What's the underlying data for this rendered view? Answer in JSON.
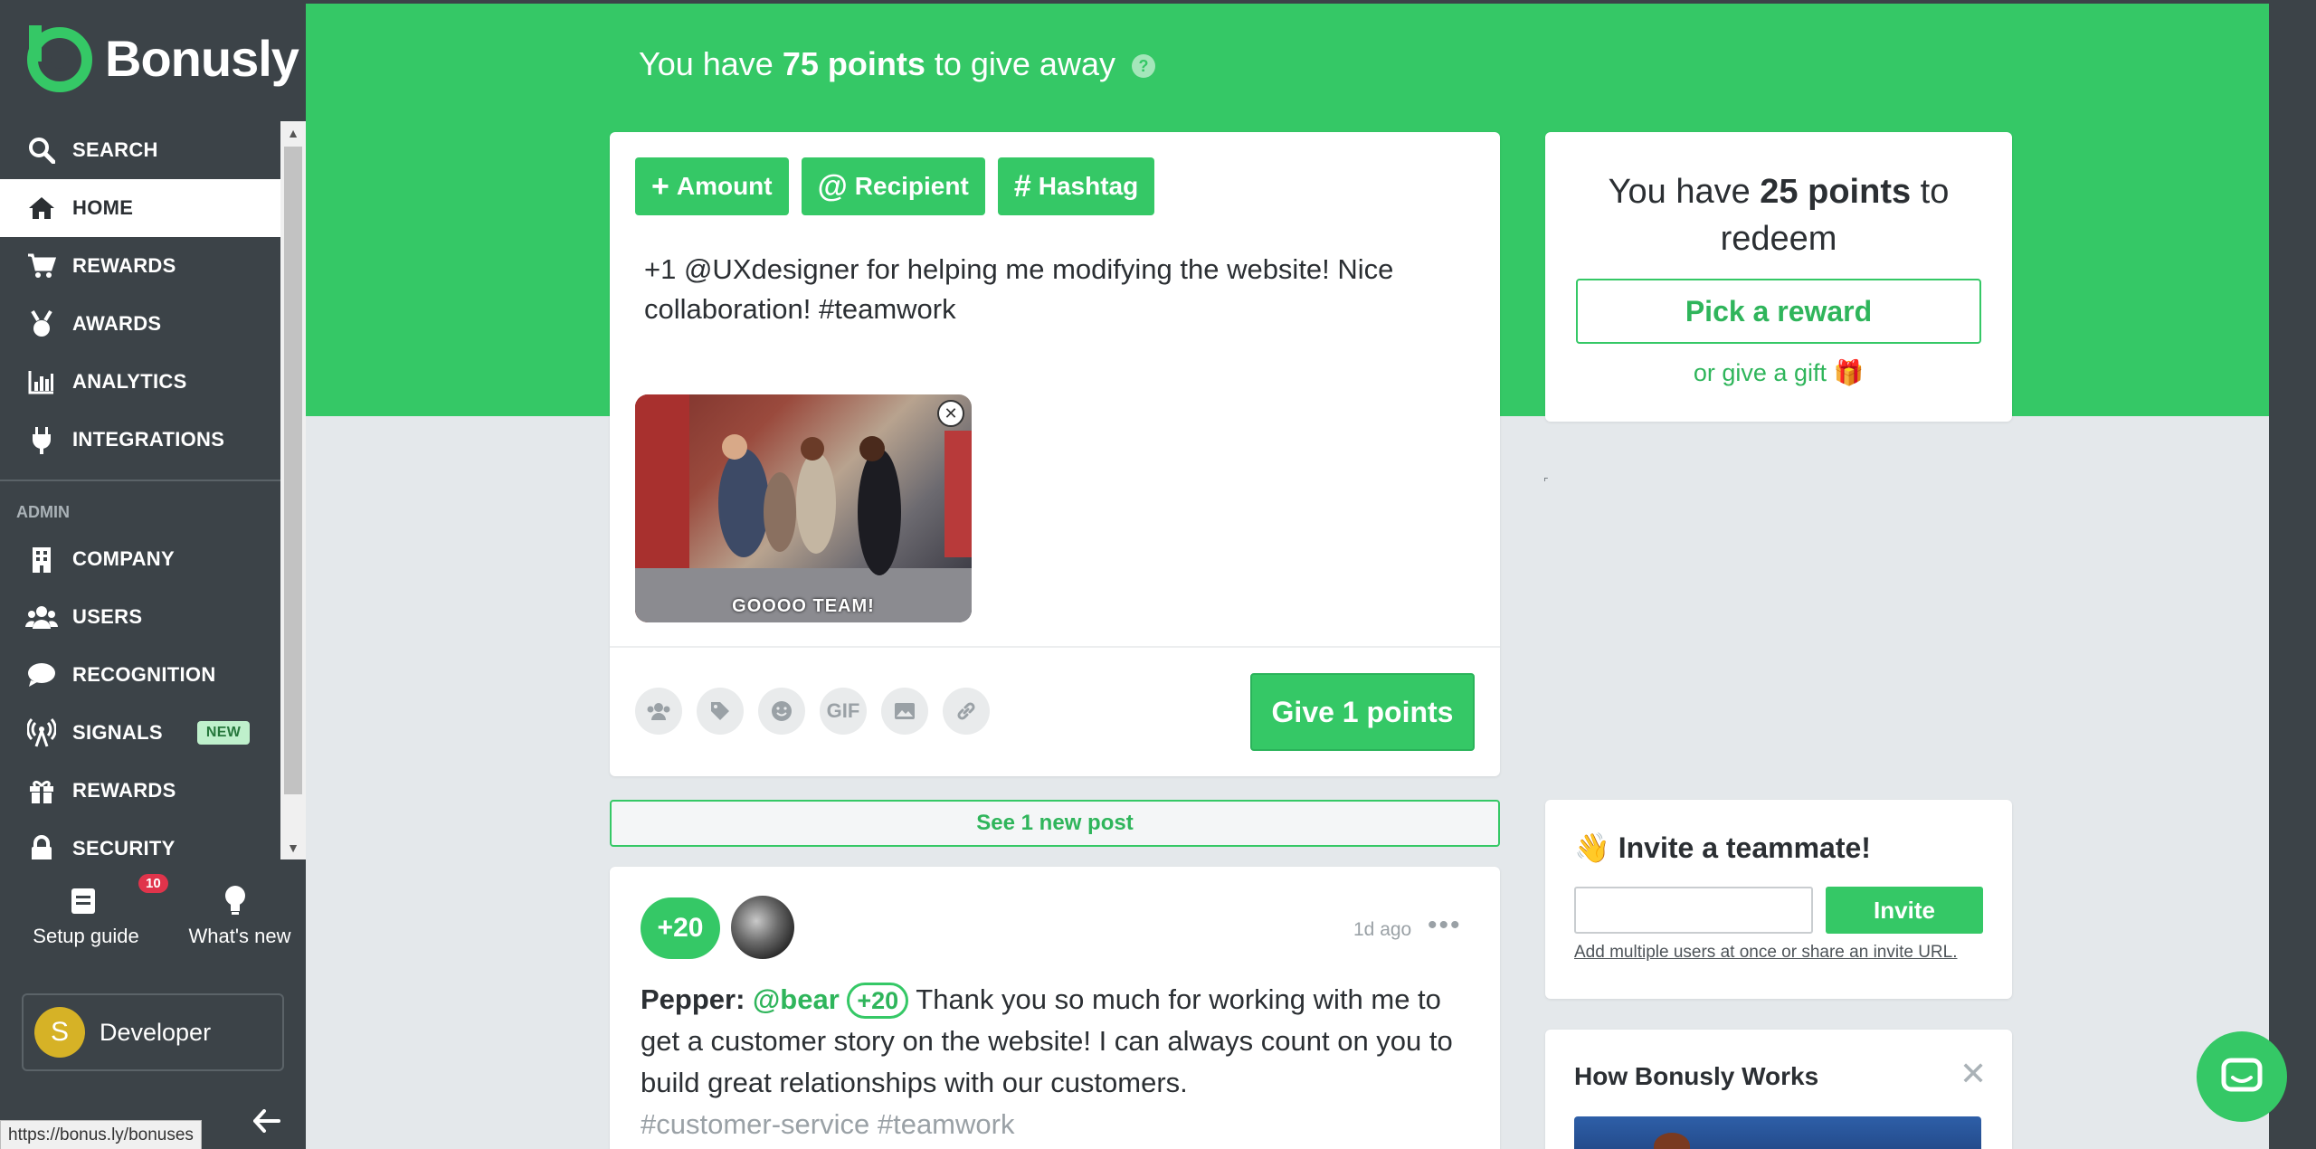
{
  "app": {
    "brand_name": "Bonusly",
    "accent_color": "#35c866",
    "sidebar_color": "#3c4348"
  },
  "sidebar": {
    "nav": [
      {
        "label": "SEARCH",
        "icon": "search-icon"
      },
      {
        "label": "HOME",
        "icon": "home-icon",
        "active": true
      },
      {
        "label": "REWARDS",
        "icon": "cart-icon"
      },
      {
        "label": "AWARDS",
        "icon": "medal-icon"
      },
      {
        "label": "ANALYTICS",
        "icon": "bar-chart-icon"
      },
      {
        "label": "INTEGRATIONS",
        "icon": "plug-icon"
      }
    ],
    "admin_section_label": "ADMIN",
    "admin_nav": [
      {
        "label": "COMPANY",
        "icon": "building-icon"
      },
      {
        "label": "USERS",
        "icon": "users-icon"
      },
      {
        "label": "RECOGNITION",
        "icon": "chat-bubble-icon"
      },
      {
        "label": "SIGNALS",
        "icon": "broadcast-icon",
        "badge": "NEW"
      },
      {
        "label": "REWARDS",
        "icon": "gift-icon"
      },
      {
        "label": "SECURITY",
        "icon": "lock-icon"
      }
    ],
    "setup_guide_label": "Setup guide",
    "setup_guide_count": "10",
    "whats_new_label": "What's new",
    "profile_initial": "S",
    "profile_name": "Developer"
  },
  "status_bar": {
    "url": "https://bonus.ly/bonuses"
  },
  "hero": {
    "prefix": "You have ",
    "points": "75 points",
    "suffix": " to give away"
  },
  "composer": {
    "amount_label": "Amount",
    "recipient_label": "Recipient",
    "hashtag_label": "Hashtag",
    "message": "+1 @UXdesigner for helping me modifying the website! Nice collaboration! #teamwork",
    "gif_caption": "GOOOO TEAM!",
    "tool_gif_label": "GIF",
    "give_button_label": "Give 1 points"
  },
  "new_post_label": "See 1 new post",
  "post": {
    "points": "+20",
    "time": "1d ago",
    "author": "Pepper:",
    "mention": "@bear",
    "inline_points": "+20",
    "text": "Thank you so much for working with me to get a customer story on the website! I can always count on you to build great relationships with our customers.",
    "tags": "#customer-service #teamwork"
  },
  "redeem": {
    "prefix": "You have ",
    "points": "25 points",
    "suffix": " to redeem",
    "pick_label": "Pick a reward",
    "gift_label": "or give a gift 🎁"
  },
  "invite": {
    "title": "👋 Invite a teammate!",
    "button_label": "Invite",
    "input_value": "",
    "link_label": "Add multiple users at once or share an invite URL."
  },
  "how": {
    "title": "How Bonusly Works",
    "close": "✕"
  }
}
